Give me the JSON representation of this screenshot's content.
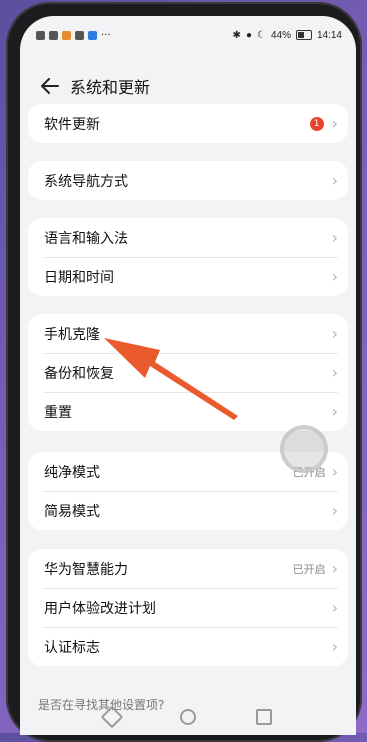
{
  "status": {
    "battery": "44%",
    "time": "14:14"
  },
  "header": {
    "title": "系统和更新"
  },
  "groups": [
    [
      {
        "label": "软件更新",
        "badge": "1"
      }
    ],
    [
      {
        "label": "系统导航方式"
      }
    ],
    [
      {
        "label": "语言和输入法"
      },
      {
        "label": "日期和时间"
      }
    ],
    [
      {
        "label": "手机克隆"
      },
      {
        "label": "备份和恢复"
      },
      {
        "label": "重置"
      }
    ],
    [
      {
        "label": "纯净模式",
        "value": "已开启"
      },
      {
        "label": "简易模式"
      }
    ],
    [
      {
        "label": "华为智慧能力",
        "value": "已开启"
      },
      {
        "label": "用户体验改进计划"
      },
      {
        "label": "认证标志"
      }
    ]
  ],
  "footer": {
    "hint": "是否在寻找其他设置项?"
  },
  "icons": {
    "back": "back-arrow-icon",
    "chevron": "chevron-right-icon"
  },
  "colors": {
    "badge": "#e8452e",
    "arrow": "#e95a2c"
  }
}
